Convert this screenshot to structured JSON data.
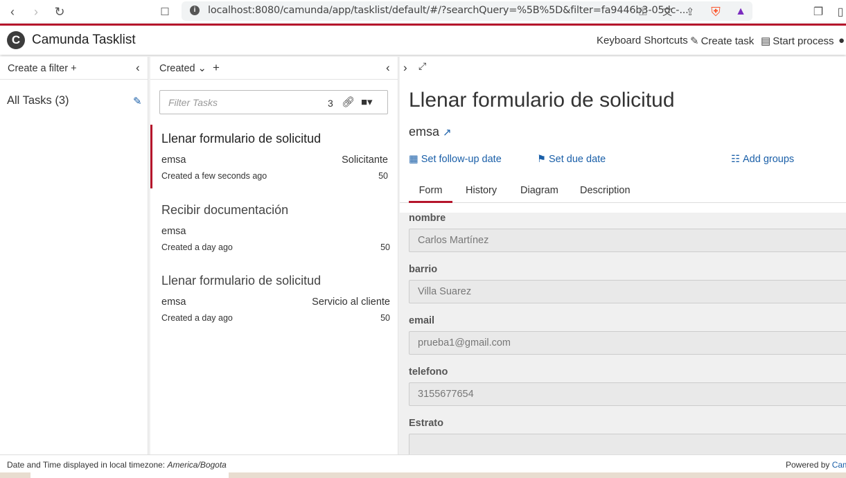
{
  "browser": {
    "url": "localhost:8080/camunda/app/tasklist/default/#/?searchQuery=%5B%5D&filter=fa9446b3-05dc-..."
  },
  "header": {
    "app_title": "Camunda Tasklist",
    "logo_letter": "C",
    "keyboard_shortcuts": "Keyboard Shortcuts",
    "create_task": "Create task",
    "start_process": "Start process"
  },
  "filters": {
    "create_filter_label": "Create a filter",
    "items": [
      {
        "label": "All Tasks (3)"
      }
    ]
  },
  "task_list": {
    "sort_label": "Created",
    "search_placeholder": "Filter Tasks",
    "result_count": "3",
    "tasks": [
      {
        "name": "Llenar formulario de solicitud",
        "assignee": "emsa",
        "group": "Solicitante",
        "created": "Created a few seconds ago",
        "priority": "50"
      },
      {
        "name": "Recibir documentación",
        "assignee": "emsa",
        "group": "",
        "created": "Created a day ago",
        "priority": "50"
      },
      {
        "name": "Llenar formulario de solicitud",
        "assignee": "emsa",
        "group": "Servicio al cliente",
        "created": "Created a day ago",
        "priority": "50"
      }
    ]
  },
  "detail": {
    "title": "Llenar formulario de solicitud",
    "assignee": "emsa",
    "actions": {
      "follow_up": "Set follow-up date",
      "due_date": "Set due date",
      "groups": "Add groups"
    },
    "tabs": [
      "Form",
      "History",
      "Diagram",
      "Description"
    ],
    "active_tab": "Form",
    "form": [
      {
        "label": "nombre",
        "value": "Carlos Martínez"
      },
      {
        "label": "barrio",
        "value": "Villa Suarez"
      },
      {
        "label": "email",
        "value": "prueba1@gmail.com"
      },
      {
        "label": "telefono",
        "value": "3155677654"
      },
      {
        "label": "Estrato",
        "value": ""
      }
    ]
  },
  "footer": {
    "timezone_prefix": "Date and Time displayed in local timezone: ",
    "timezone": "America/Bogota",
    "powered_by": "Powered by ",
    "powered_brand": "Cam"
  },
  "colors": {
    "accent": "#b5152b",
    "link": "#1a5fa8"
  }
}
